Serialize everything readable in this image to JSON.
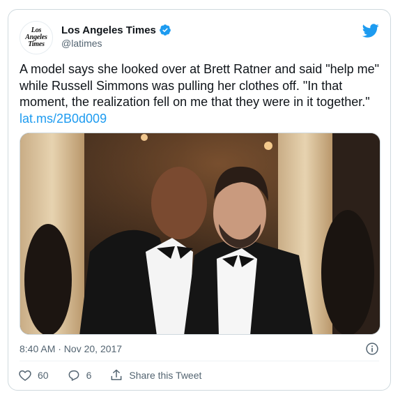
{
  "account": {
    "display_name": "Los Angeles Times",
    "handle": "@latimes",
    "avatar_lines": [
      "Los",
      "Angeles",
      "Times"
    ]
  },
  "tweet": {
    "text": "A model says she looked over at Brett Ratner and said \"help me\" while Russell Simmons was pulling her clothes off. \"In that moment, the realization fell on me that they were in it together.\" ",
    "link": "lat.ms/2B0d009",
    "timestamp": "8:40 AM · Nov 20, 2017"
  },
  "actions": {
    "like_count": "60",
    "reply_count": "6",
    "share_label": "Share this Tweet"
  },
  "icons": {
    "brand": "twitter-bird-icon",
    "verified": "verified-badge-icon",
    "info": "info-icon",
    "like": "heart-icon",
    "reply": "reply-icon",
    "share": "share-icon"
  },
  "colors": {
    "accent": "#1d9bf0",
    "text_primary": "#0f1419",
    "text_secondary": "#536471",
    "border": "#cfd9de"
  }
}
